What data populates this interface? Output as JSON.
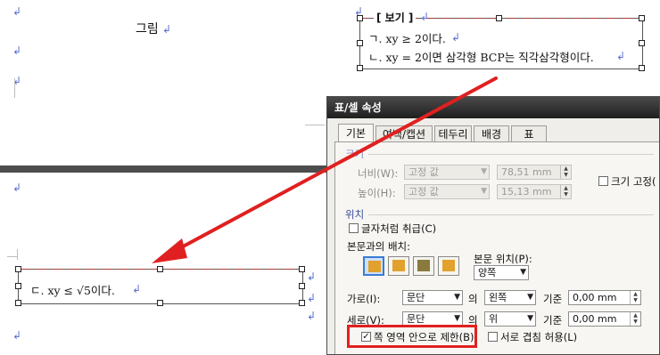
{
  "doc": {
    "figure_label": "그림",
    "box_title": "[ 보기 ]",
    "item1": "ㄱ. xy ≥ 2이다.",
    "item2": "ㄴ. xy = 2이면 삼각형 BCP는 직각삼각형이다.",
    "item3_pre": "ㄷ. xy ≤ √5",
    "item3_post": "이다."
  },
  "dialog": {
    "title": "표/셀 속성",
    "tabs": [
      "기본",
      "여백/캡션",
      "테두리",
      "배경",
      "표"
    ],
    "size_group": "크기",
    "width_label": "너비(W):",
    "width_mode": "고정 값",
    "width_value": "78,51 mm",
    "height_label": "높이(H):",
    "height_mode": "고정 값",
    "height_value": "15,13 mm",
    "fix_size_label": "크기 고정(",
    "position_group": "위치",
    "treat_as_char_label": "글자처럼 취급(C)",
    "wrap_label": "본문과의 배치:",
    "text_position_label": "본문 위치(P):",
    "text_position_value": "양쪽",
    "horiz_label": "가로(I):",
    "horiz_ref": "문단",
    "horiz_of": "의",
    "horiz_align": "왼쪽",
    "horiz_base": "기준",
    "horiz_value": "0,00 mm",
    "vert_label": "세로(V):",
    "vert_ref": "문단",
    "vert_of": "의",
    "vert_align": "위",
    "vert_base": "기준",
    "vert_value": "0,00 mm",
    "limit_page_label": "쪽 영역 안으로 제한(B)",
    "allow_overlap_label": "서로 겹침 허용(L)"
  },
  "colors": {
    "annotation_red": "#e02020",
    "selected_blue": "#3a7bd5"
  }
}
